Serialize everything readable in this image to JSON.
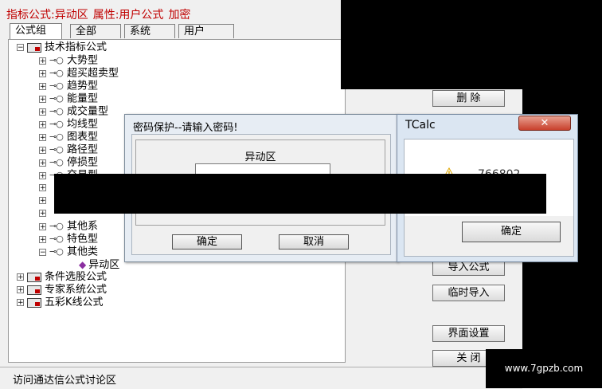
{
  "main": {
    "title": {
      "formula_label": "指标公式:异动区",
      "attr_label": "属性:用户公式",
      "encrypted": "加密"
    },
    "tabs": [
      "公式组",
      "全部",
      "系统",
      "用户"
    ],
    "tree": {
      "root": "技术指标公式",
      "children": [
        "大势型",
        "超买超卖型",
        "趋势型",
        "能量型",
        "成交量型",
        "均线型",
        "图表型",
        "路径型",
        "停损型",
        "交易型",
        "其他系",
        "特色型",
        "其他类"
      ],
      "leaf": "异动区",
      "other_roots": [
        "条件选股公式",
        "专家系统公式",
        "五彩K线公式"
      ]
    },
    "side_buttons": {
      "delete": "删  除",
      "import": "导入公式",
      "temp_import": "临时导入",
      "ui_settings": "界面设置",
      "close": "关  闭"
    },
    "status": "访问通达信公式讨论区"
  },
  "password_dialog": {
    "title": "密码保护--请输入密码!",
    "label": "异动区",
    "input_value": "",
    "ok": "确定",
    "cancel": "取消"
  },
  "tcalc_dialog": {
    "title": "TCalc",
    "close": "✕",
    "message": "766802",
    "ok": "确定"
  },
  "watermark": "www.7gpzb.com"
}
